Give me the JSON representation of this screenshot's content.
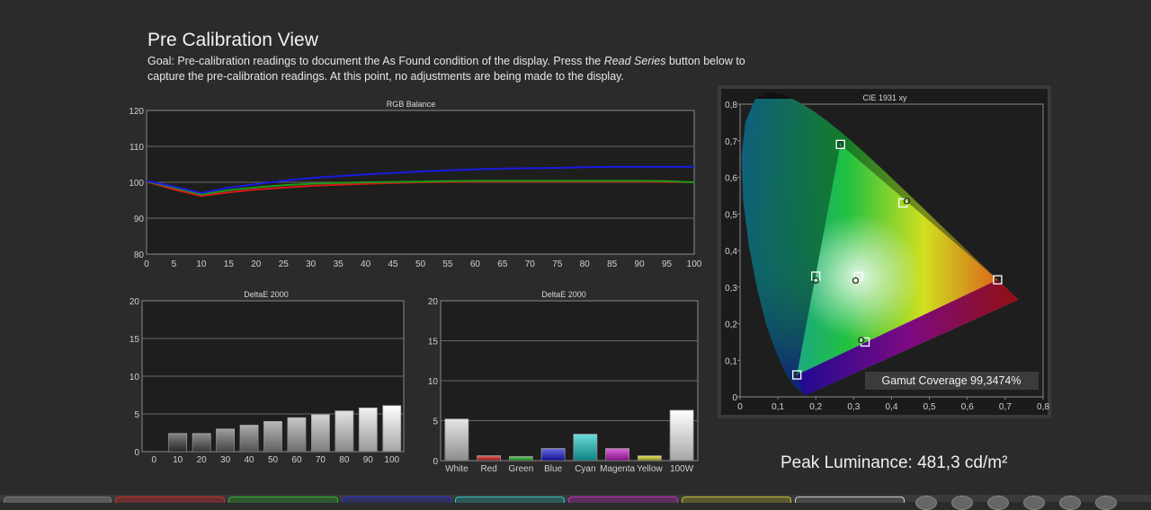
{
  "header": {
    "title": "Pre Calibration View",
    "goal_prefix": "Goal: Pre-calibration readings to document the As Found condition of the display. Press the ",
    "goal_button": "Read Series",
    "goal_suffix": " button below to capture the pre-calibration readings. At this point, no adjustments are being made to the display."
  },
  "peak_luminance": "Peak Luminance: 481,3 cd/m²",
  "gamut_coverage": "Gamut Coverage 99,3474%",
  "colors": {
    "red": "#d81818",
    "green": "#1a9a1a",
    "blue": "#1a1ae0",
    "background": "#2b2b2b",
    "plot_bg": "#1e1e1e"
  },
  "chart_data": [
    {
      "type": "line",
      "title": "RGB Balance",
      "x": [
        0,
        5,
        10,
        15,
        20,
        25,
        30,
        35,
        40,
        45,
        50,
        55,
        60,
        65,
        70,
        75,
        80,
        85,
        90,
        95,
        100
      ],
      "xlim": [
        0,
        100
      ],
      "ylim": [
        80,
        120
      ],
      "yticks": [
        80,
        90,
        100,
        110,
        120
      ],
      "grid": true,
      "series": [
        {
          "color": "#d81818",
          "values": [
            100.2,
            98,
            96.2,
            97.2,
            98,
            98.5,
            99,
            99.3,
            99.6,
            99.8,
            100,
            100.1,
            100.2,
            100.2,
            100.2,
            100.2,
            100.2,
            100.2,
            100.2,
            100.1,
            100
          ]
        },
        {
          "color": "#1a9a1a",
          "values": [
            100.3,
            98.5,
            96.6,
            97.8,
            98.6,
            99.2,
            99.6,
            99.8,
            100,
            100.1,
            100.2,
            100.3,
            100.4,
            100.4,
            100.4,
            100.4,
            100.4,
            100.4,
            100.4,
            100.3,
            100
          ]
        },
        {
          "color": "#1a1ae0",
          "values": [
            100.4,
            98.8,
            97,
            98.5,
            99.5,
            100.4,
            101.2,
            101.7,
            102.2,
            102.6,
            103,
            103.3,
            103.6,
            103.8,
            103.9,
            104,
            104.2,
            104.3,
            104.3,
            104.3,
            104.3
          ]
        }
      ]
    },
    {
      "type": "bar",
      "title": "DeltaE 2000",
      "categories": [
        "0",
        "10",
        "20",
        "30",
        "40",
        "50",
        "60",
        "70",
        "80",
        "90",
        "100"
      ],
      "values": [
        0,
        2.4,
        2.4,
        3.0,
        3.5,
        4.0,
        4.5,
        4.9,
        5.4,
        5.8,
        6.1
      ],
      "ylim": [
        0,
        20
      ],
      "yticks": [
        0,
        5,
        10,
        15,
        20
      ],
      "grid": true
    },
    {
      "type": "bar",
      "title": "DeltaE 2000",
      "categories": [
        "White",
        "Red",
        "Green",
        "Blue",
        "Cyan",
        "Magenta",
        "Yellow",
        "100W"
      ],
      "values": [
        5.2,
        0.6,
        0.5,
        1.5,
        3.3,
        1.5,
        0.6,
        6.3
      ],
      "bar_colors": [
        "#d8d8d8",
        "#d81818",
        "#18b818",
        "#1818d8",
        "#18c8c8",
        "#c818c8",
        "#d8d818",
        "#ffffff"
      ],
      "ylim": [
        0,
        20
      ],
      "yticks": [
        0,
        5,
        10,
        15,
        20
      ],
      "grid": true
    },
    {
      "type": "scatter",
      "title": "CIE 1931 xy",
      "xlim": [
        0,
        0.8
      ],
      "ylim": [
        0,
        0.8
      ],
      "xticks": [
        "0",
        "0,1",
        "0,2",
        "0,3",
        "0,4",
        "0,5",
        "0,6",
        "0,7",
        "0,8"
      ],
      "yticks": [
        "0",
        "0,1",
        "0,2",
        "0,3",
        "0,4",
        "0,5",
        "0,6",
        "0,7",
        "0,8"
      ],
      "targets": [
        {
          "name": "R",
          "x": 0.68,
          "y": 0.32
        },
        {
          "name": "G",
          "x": 0.265,
          "y": 0.69
        },
        {
          "name": "B",
          "x": 0.15,
          "y": 0.06
        },
        {
          "name": "C",
          "x": 0.2,
          "y": 0.33
        },
        {
          "name": "M",
          "x": 0.33,
          "y": 0.15
        },
        {
          "name": "Y",
          "x": 0.43,
          "y": 0.53
        },
        {
          "name": "W",
          "x": 0.3127,
          "y": 0.329
        }
      ],
      "measured": [
        {
          "name": "R",
          "x": 0.68,
          "y": 0.32
        },
        {
          "name": "G",
          "x": 0.265,
          "y": 0.69
        },
        {
          "name": "B",
          "x": 0.15,
          "y": 0.06
        },
        {
          "name": "C",
          "x": 0.2,
          "y": 0.318
        },
        {
          "name": "M",
          "x": 0.32,
          "y": 0.155
        },
        {
          "name": "Y",
          "x": 0.44,
          "y": 0.535
        },
        {
          "name": "W",
          "x": 0.305,
          "y": 0.318
        }
      ]
    }
  ]
}
